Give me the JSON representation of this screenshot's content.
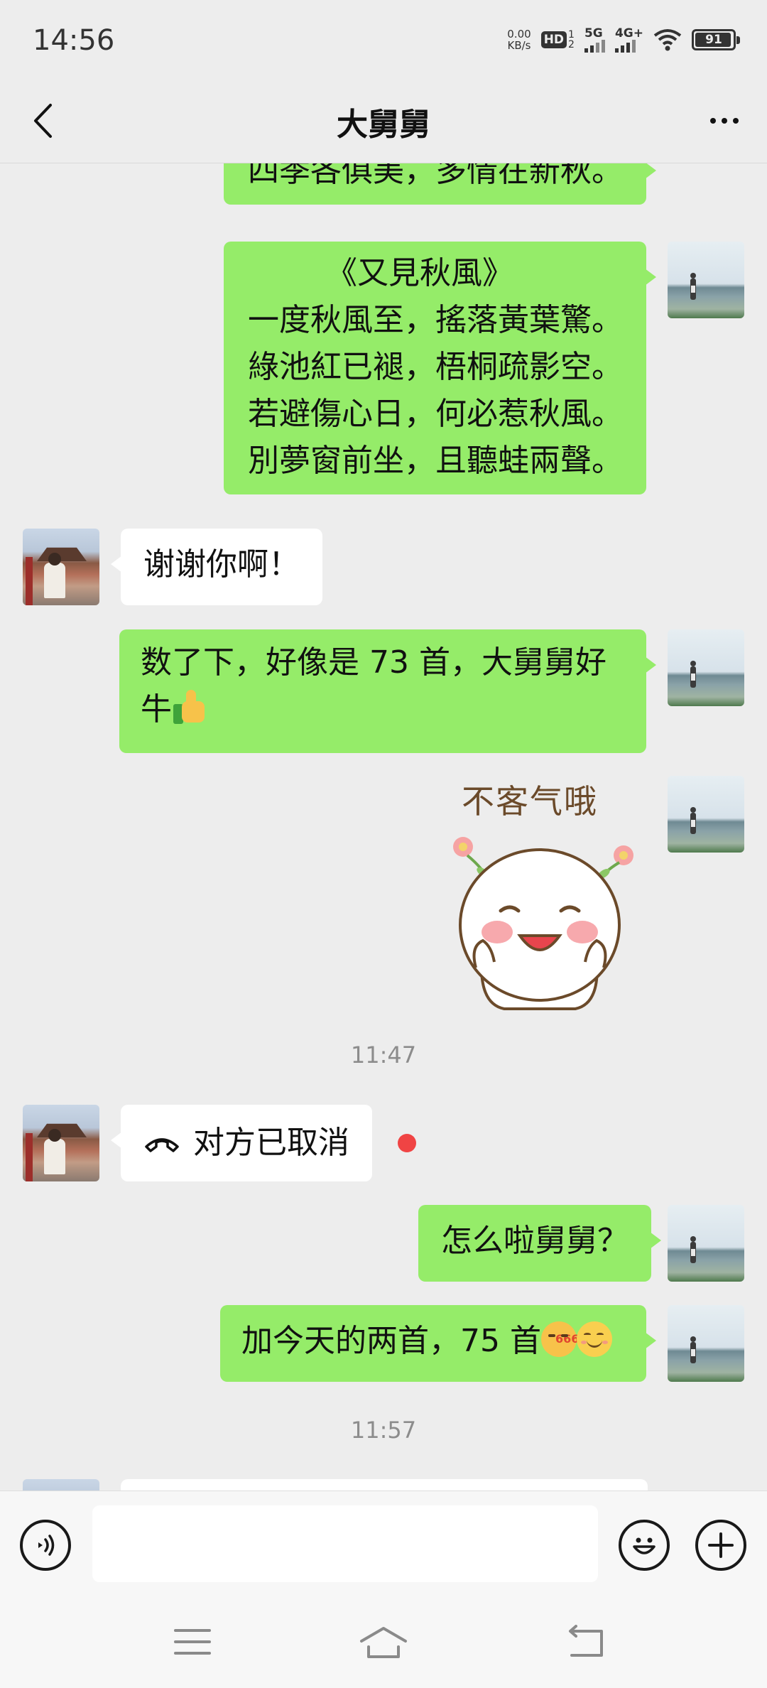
{
  "status_bar": {
    "time": "14:56",
    "net_speed_value": "0.00",
    "net_speed_unit": "KB/s",
    "hd_label": "HD",
    "hd_sub_top": "1",
    "hd_sub_bottom": "2",
    "signal1_label": "5G",
    "signal2_label": "4G+",
    "battery_percent": "91"
  },
  "header": {
    "title": "大舅舅"
  },
  "messages": {
    "m1": {
      "lines": [
        "四季各俱美，多情在新秋。"
      ]
    },
    "m2": {
      "lines": [
        "《又見秋風》",
        "一度秋風至，搖落黃葉驚。",
        "綠池紅已褪，梧桐疏影空。",
        "若避傷心日，何必惹秋風。",
        "別夢窗前坐，且聽蛙兩聲。"
      ]
    },
    "m3": {
      "text": "谢谢你啊！"
    },
    "m4": {
      "line1": "数了下，好像是 73 首，大舅舅好",
      "line2": "牛"
    },
    "m5": {
      "sticker_text": "不客气哦"
    },
    "ts1": "11:47",
    "m6": {
      "text": "对方已取消"
    },
    "m7": {
      "text": "怎么啦舅舅？"
    },
    "m8": {
      "text": "加今天的两首，75 首",
      "emoji_badge": "666"
    },
    "ts2": "11:57"
  },
  "input": {
    "value": "",
    "placeholder": ""
  },
  "icons": {
    "back": "chevron-left-icon",
    "more": "more-icon",
    "voice": "voice-icon",
    "emoji": "emoji-icon",
    "plus": "plus-icon",
    "phone": "phone-hangup-icon",
    "menu": "menu-icon",
    "home": "home-icon",
    "return": "return-icon"
  },
  "colors": {
    "background": "#ededed",
    "bubble_me": "#95ec69",
    "bubble_other": "#ffffff",
    "unread_dot": "#f04444",
    "timestamp": "#8c8c8c"
  }
}
